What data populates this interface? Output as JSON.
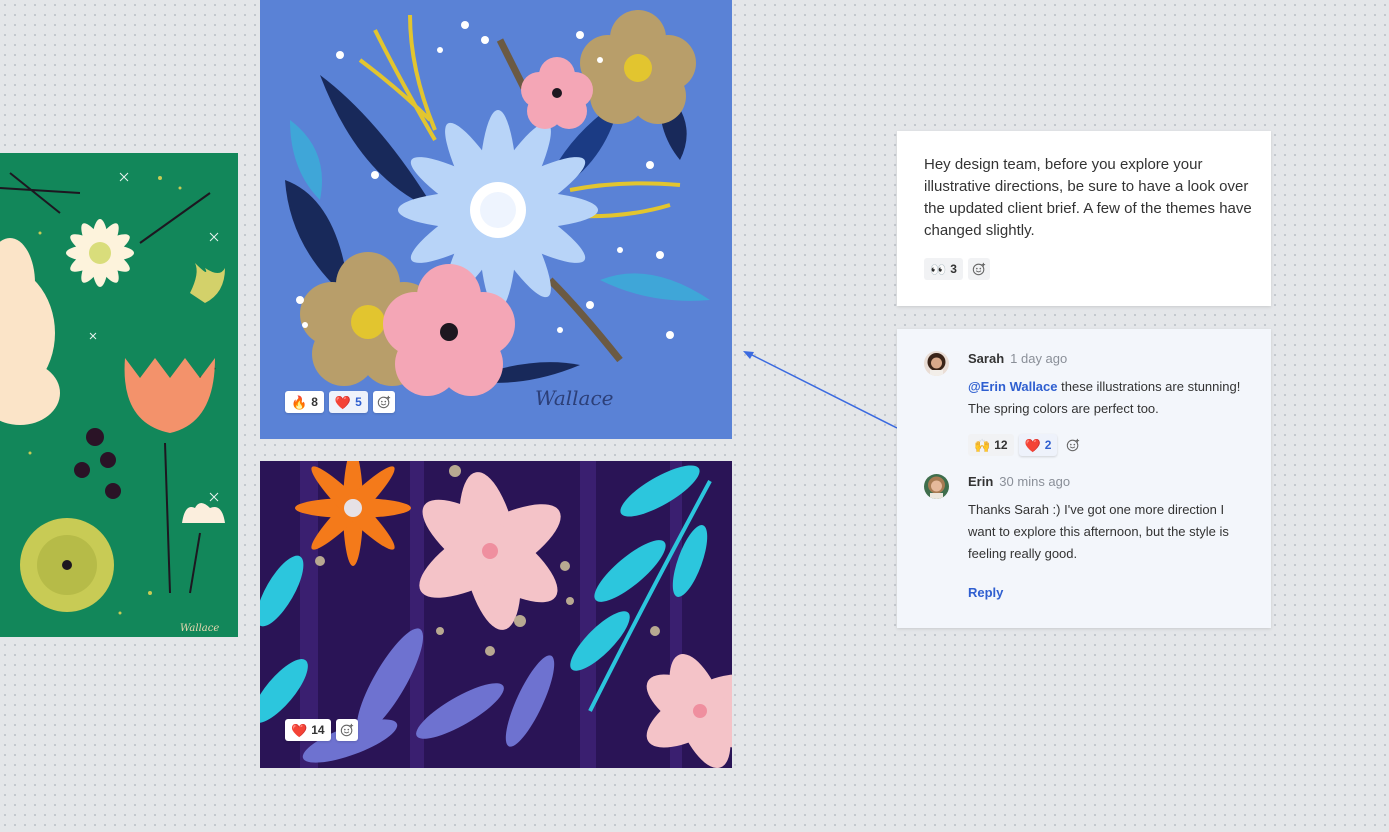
{
  "artworks": {
    "green": {
      "watermark": "Wallace"
    },
    "blue": {
      "watermark": "Wallace",
      "reactions": [
        {
          "emoji": "🔥",
          "count": "8",
          "liked": false
        },
        {
          "emoji": "❤️",
          "count": "5",
          "liked": true
        }
      ]
    },
    "purple": {
      "reactions": [
        {
          "emoji": "❤️",
          "count": "14",
          "liked": false
        }
      ]
    }
  },
  "note": {
    "text": "Hey design team, before you explore your illustrative directions, be sure to have a look over the updated client brief. A few of the themes have changed slightly.",
    "reactions": [
      {
        "emoji": "👀",
        "count": "3"
      }
    ]
  },
  "thread": {
    "comments": [
      {
        "author": "Sarah",
        "time": "1 day ago",
        "mention": "@Erin Wallace",
        "body": " these illustrations are stunning! The spring colors are perfect too.",
        "reactions": [
          {
            "emoji": "🙌",
            "count": "12",
            "liked": false
          },
          {
            "emoji": "❤️",
            "count": "2",
            "liked": true
          }
        ]
      },
      {
        "author": "Erin",
        "time": "30 mins ago",
        "body": "Thanks Sarah :) I've got one more direction I want to explore this afternoon, but the style is feeling really good."
      }
    ],
    "reply_label": "Reply"
  },
  "colors": {
    "accent": "#2f5fd0",
    "canvas": "#e4e6e9",
    "green_art": "#12875a",
    "blue_art": "#5a82d6",
    "purple_art": "#2a1456"
  },
  "icons": [
    "add-reaction-icon"
  ]
}
